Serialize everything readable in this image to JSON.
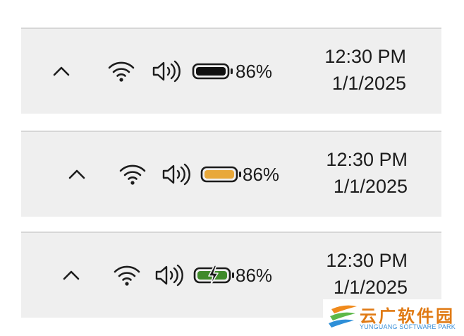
{
  "trays": [
    {
      "battery_state": "normal",
      "battery_color": "#111111",
      "battery_percent": "86%",
      "time": "12:30 PM",
      "date": "1/1/2025"
    },
    {
      "battery_state": "saver",
      "battery_color": "#e8a83a",
      "battery_percent": "86%",
      "time": "12:30 PM",
      "date": "1/1/2025"
    },
    {
      "battery_state": "charging",
      "battery_color": "#3f8a2a",
      "battery_percent": "86%",
      "time": "12:30 PM",
      "date": "1/1/2025"
    }
  ],
  "icons": {
    "chevron": "chevron-up-icon",
    "wifi": "wifi-icon",
    "volume": "volume-icon",
    "battery": "battery-icon"
  },
  "watermark": {
    "chinese": "云广软件园",
    "english": "YUNGUANG SOFTWARE PARK"
  }
}
